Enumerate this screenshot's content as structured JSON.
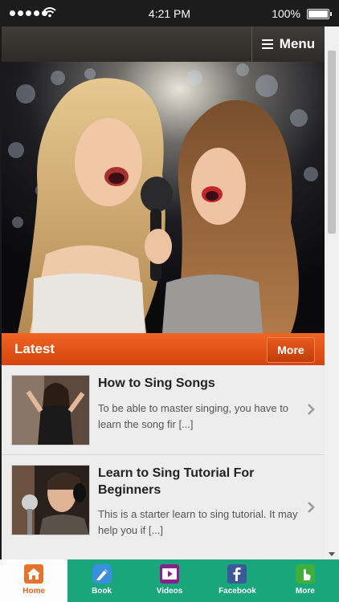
{
  "status": {
    "time": "4:21 PM",
    "battery": "100%"
  },
  "header": {
    "menu_label": "Menu"
  },
  "latest": {
    "title": "Latest",
    "more_label": "More"
  },
  "posts": [
    {
      "title": "How to Sing Songs",
      "excerpt": "To be able to master singing, you have to learn the song fir [...]"
    },
    {
      "title": "Learn to Sing Tutorial For Beginners",
      "excerpt": "This is a starter learn to sing tutorial. It may help you if [...]"
    }
  ],
  "tabs": [
    {
      "label": "Home",
      "icon": "home-icon"
    },
    {
      "label": "Book",
      "icon": "book-icon"
    },
    {
      "label": "Videos",
      "icon": "video-icon"
    },
    {
      "label": "Facebook",
      "icon": "facebook-icon"
    },
    {
      "label": "More",
      "icon": "more-icon"
    }
  ],
  "colors": {
    "accent": "#E8561A",
    "tabbar": "#18A67A",
    "topbar": "#3A3633"
  }
}
